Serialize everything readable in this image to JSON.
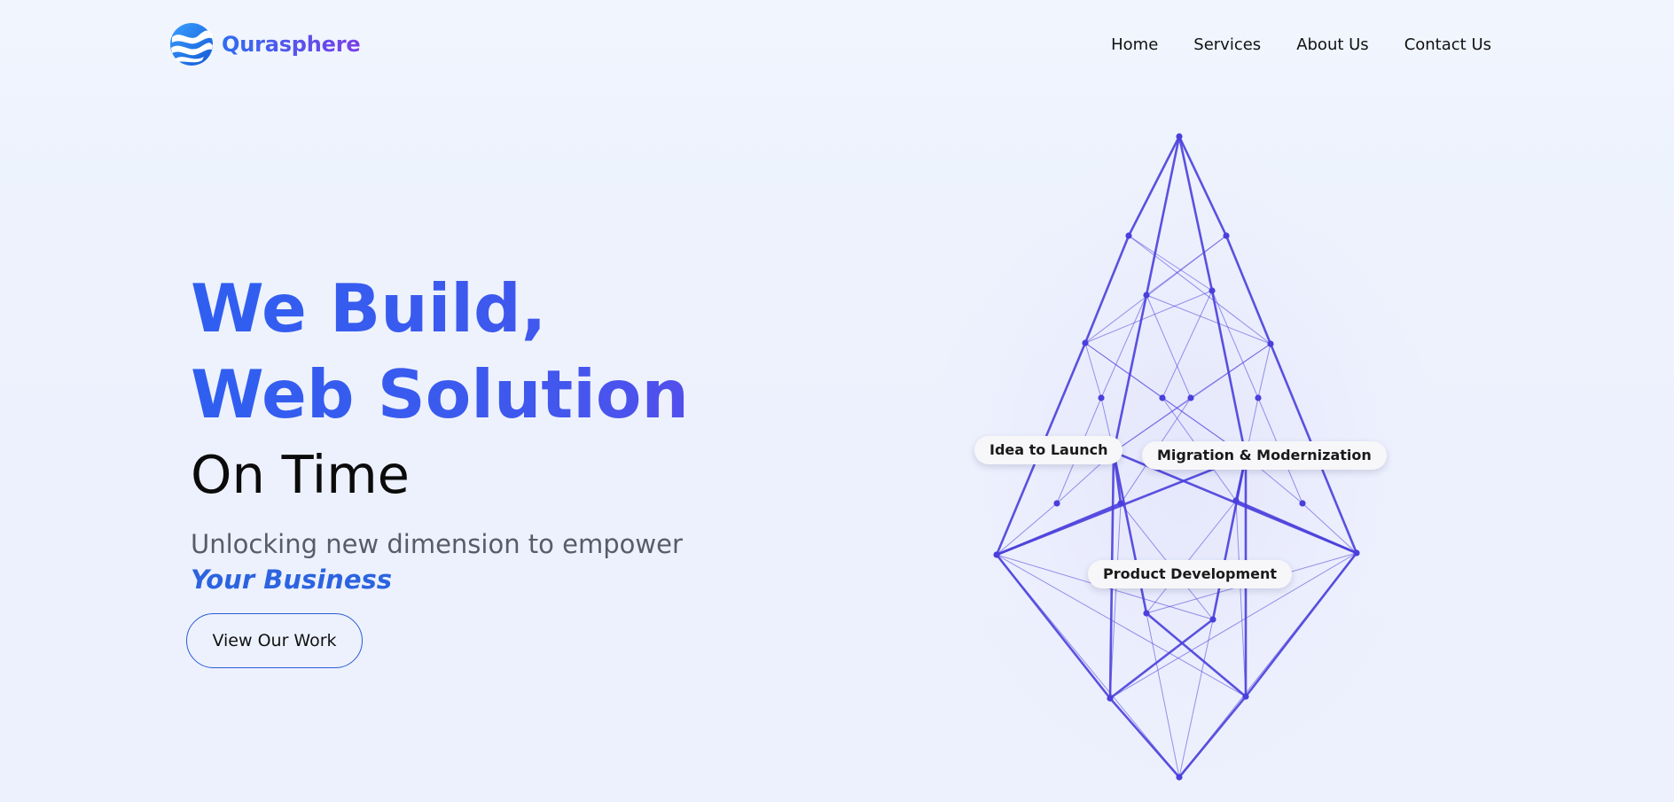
{
  "brand": {
    "name": "Qurasphere",
    "icon": "wave-sphere-logo-icon"
  },
  "nav": {
    "items": [
      {
        "label": "Home"
      },
      {
        "label": "Services"
      },
      {
        "label": "About Us"
      },
      {
        "label": "Contact Us"
      }
    ]
  },
  "hero": {
    "line1": "We Build,",
    "line2": "Web Solution",
    "line3": "On Time",
    "tagline": "Unlocking new dimension to empower",
    "tagline_emphasis": "Your Business",
    "cta_label": "View Our Work"
  },
  "graphic": {
    "icon": "wireframe-diamond-illustration",
    "labels": {
      "idea": "Idea to Launch",
      "migration": "Migration & Modernization",
      "product": "Product Development"
    }
  },
  "colors": {
    "background": "#eef3fd",
    "accent_blue": "#2f5ff0",
    "accent_purple": "#6248ea",
    "wireframe": "#4a3fdc",
    "emphasis": "#2c63e0",
    "button_border": "#2c5bd7"
  }
}
